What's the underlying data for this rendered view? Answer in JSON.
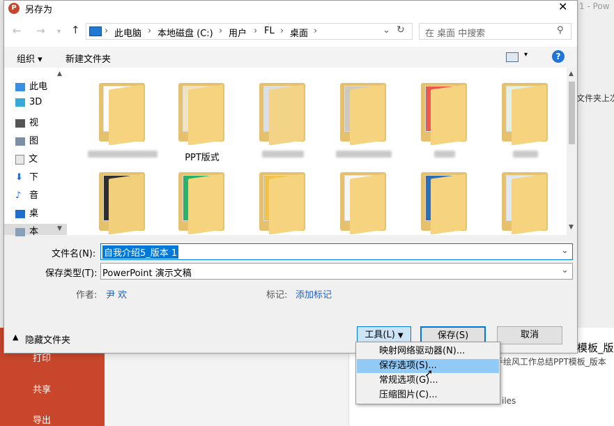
{
  "background": {
    "right_title_fragment": "1 - Pow",
    "right_text_1": "文件夹上次",
    "panel_heading": "模板_版本",
    "panel_sub": "手绘风工作总结PPT模板_版本",
    "panel_files": "iles",
    "sidebar_items": [
      "打印",
      "共享",
      "导出"
    ]
  },
  "dialog": {
    "title": "另存为",
    "address": {
      "segments": [
        "此电脑",
        "本地磁盘 (C:)",
        "用户",
        "FL",
        "桌面"
      ]
    },
    "search": {
      "placeholder": "在 桌面 中搜索"
    },
    "toolbar": {
      "organize": "组织 ▾",
      "new_folder": "新建文件夹"
    },
    "nav_items": [
      "此电",
      "3D",
      "视",
      "图",
      "文",
      "下",
      "音",
      "桌",
      "本"
    ],
    "files_row1": [
      "",
      "PPT版式",
      "",
      "",
      "",
      ""
    ],
    "file_name_label": "文件名(N):",
    "file_name_value": "自我介绍5_版本 1",
    "save_type_label": "保存类型(T):",
    "save_type_value": "PowerPoint 演示文稿",
    "author_label": "作者:",
    "author_value": "尹 欢",
    "tags_label": "标记:",
    "tags_value": "添加标记",
    "hide_folders": "隐藏文件夹",
    "tools_button": "工具(L)",
    "save_button": "保存(S)",
    "cancel_button": "取消",
    "tools_menu": [
      "映射网络驱动器(N)...",
      "保存选项(S)...",
      "常规选项(G)...",
      "压缩图片(C)..."
    ]
  }
}
